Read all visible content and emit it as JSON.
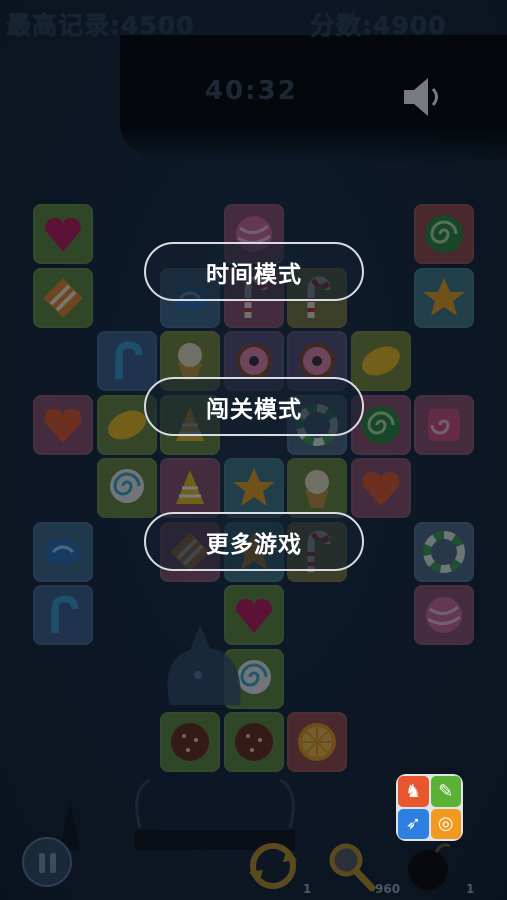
{
  "hud": {
    "best_record": "最高记录:4500",
    "score": "分数:4900",
    "timer": "40:32"
  },
  "menu": {
    "time_mode": "时间模式",
    "level_mode": "闯关模式",
    "more_games": "更多游戏"
  },
  "tools": {
    "shuffle_count": "1",
    "hint_count": "960",
    "bomb_count": "1"
  },
  "board": {
    "tiles": [
      {
        "row": 0,
        "col": 0,
        "candy": "heart-gem",
        "bg": "#5f8d3b"
      },
      {
        "row": 0,
        "col": 3,
        "candy": "swirl-ball",
        "bg": "#8f4f6b"
      },
      {
        "row": 0,
        "col": 6,
        "candy": "green-swirl",
        "bg": "#9a4b4b"
      },
      {
        "row": 1,
        "col": 0,
        "candy": "striped-wrap",
        "bg": "#5f8d3b"
      },
      {
        "row": 1,
        "col": 2,
        "candy": "blue-jelly",
        "bg": "#3f6a8c"
      },
      {
        "row": 1,
        "col": 3,
        "candy": "candy-cane",
        "bg": "#8f4f6b"
      },
      {
        "row": 1,
        "col": 4,
        "candy": "candy-cane",
        "bg": "#7a7a3b"
      },
      {
        "row": 1,
        "col": 6,
        "candy": "star",
        "bg": "#3f7a8a"
      },
      {
        "row": 2,
        "col": 1,
        "candy": "blue-cane",
        "bg": "#3f5f8c"
      },
      {
        "row": 2,
        "col": 2,
        "candy": "cupcake",
        "bg": "#7a8a3b"
      },
      {
        "row": 2,
        "col": 3,
        "candy": "donut",
        "bg": "#5a4f7a"
      },
      {
        "row": 2,
        "col": 4,
        "candy": "donut",
        "bg": "#5a4f7a"
      },
      {
        "row": 2,
        "col": 5,
        "candy": "lemon",
        "bg": "#7a8a3b"
      },
      {
        "row": 3,
        "col": 0,
        "candy": "heart",
        "bg": "#8f4f6b"
      },
      {
        "row": 3,
        "col": 1,
        "candy": "lemon",
        "bg": "#6a8a3b"
      },
      {
        "row": 3,
        "col": 2,
        "candy": "cone",
        "bg": "#6a8a3b"
      },
      {
        "row": 3,
        "col": 4,
        "candy": "ring",
        "bg": "#4f6a8a"
      },
      {
        "row": 3,
        "col": 5,
        "candy": "green-swirl",
        "bg": "#8f4f6b"
      },
      {
        "row": 3,
        "col": 6,
        "candy": "pink-swirl",
        "bg": "#8f4f6b"
      },
      {
        "row": 4,
        "col": 1,
        "candy": "swirl-lollipop",
        "bg": "#6a8a3b"
      },
      {
        "row": 4,
        "col": 2,
        "candy": "cone",
        "bg": "#8f4f6b"
      },
      {
        "row": 4,
        "col": 3,
        "candy": "star",
        "bg": "#3f7a8a"
      },
      {
        "row": 4,
        "col": 4,
        "candy": "cupcake",
        "bg": "#6a8a3b"
      },
      {
        "row": 4,
        "col": 5,
        "candy": "heart",
        "bg": "#8f4f6b"
      },
      {
        "row": 5,
        "col": 0,
        "candy": "blue-jelly",
        "bg": "#3f6a8c"
      },
      {
        "row": 5,
        "col": 2,
        "candy": "striped-wrap",
        "bg": "#8f4f6b"
      },
      {
        "row": 5,
        "col": 3,
        "candy": "star",
        "bg": "#3f7a8a"
      },
      {
        "row": 5,
        "col": 4,
        "candy": "candy-cane",
        "bg": "#7a7a3b"
      },
      {
        "row": 5,
        "col": 6,
        "candy": "ring",
        "bg": "#4f6a8a"
      },
      {
        "row": 6,
        "col": 0,
        "candy": "blue-cane",
        "bg": "#3f5f8c"
      },
      {
        "row": 6,
        "col": 3,
        "candy": "heart-gem",
        "bg": "#5f8d3b"
      },
      {
        "row": 6,
        "col": 6,
        "candy": "swirl-ball",
        "bg": "#8f4f6b"
      },
      {
        "row": 7,
        "col": 3,
        "candy": "swirl-lollipop",
        "bg": "#5f8d3b"
      },
      {
        "row": 8,
        "col": 2,
        "candy": "cookie",
        "bg": "#5f8d3b"
      },
      {
        "row": 8,
        "col": 3,
        "candy": "cookie",
        "bg": "#5f8d3b"
      },
      {
        "row": 8,
        "col": 4,
        "candy": "orange",
        "bg": "#9a4b4b"
      }
    ]
  },
  "colors": {
    "button_border": "#d9dde3",
    "hud_text": "#2c3d50",
    "menu_text": "#ffffff"
  }
}
